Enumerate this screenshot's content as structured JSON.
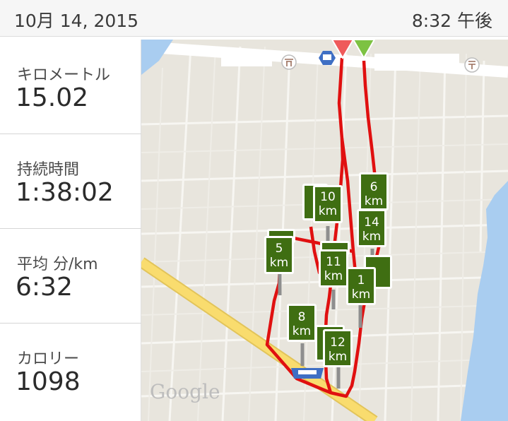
{
  "header": {
    "date": "10月 14, 2015",
    "time": "8:32 午後"
  },
  "stats": [
    {
      "label": "キロメートル",
      "value": "15.02"
    },
    {
      "label": "持続時間",
      "value": "1:38:02"
    },
    {
      "label": "平均 分/km",
      "value": "6:32"
    },
    {
      "label": "カロリー",
      "value": "1098"
    }
  ],
  "map": {
    "attribution": "Google",
    "route_color": "#e01010",
    "marker_color": "#3f6e12",
    "start_pin_color": "#7dc242",
    "end_pin_color": "#ef5a5a",
    "markers": [
      {
        "line1": "1",
        "line2": "km"
      },
      {
        "line1": "5",
        "line2": "km"
      },
      {
        "line1": "6",
        "line2": "km"
      },
      {
        "line1": "8",
        "line2": "km"
      },
      {
        "line1": "10",
        "line2": "km"
      },
      {
        "line1": "11",
        "line2": "km"
      },
      {
        "line1": "12",
        "line2": "km"
      },
      {
        "line1": "14",
        "line2": "km"
      }
    ]
  }
}
